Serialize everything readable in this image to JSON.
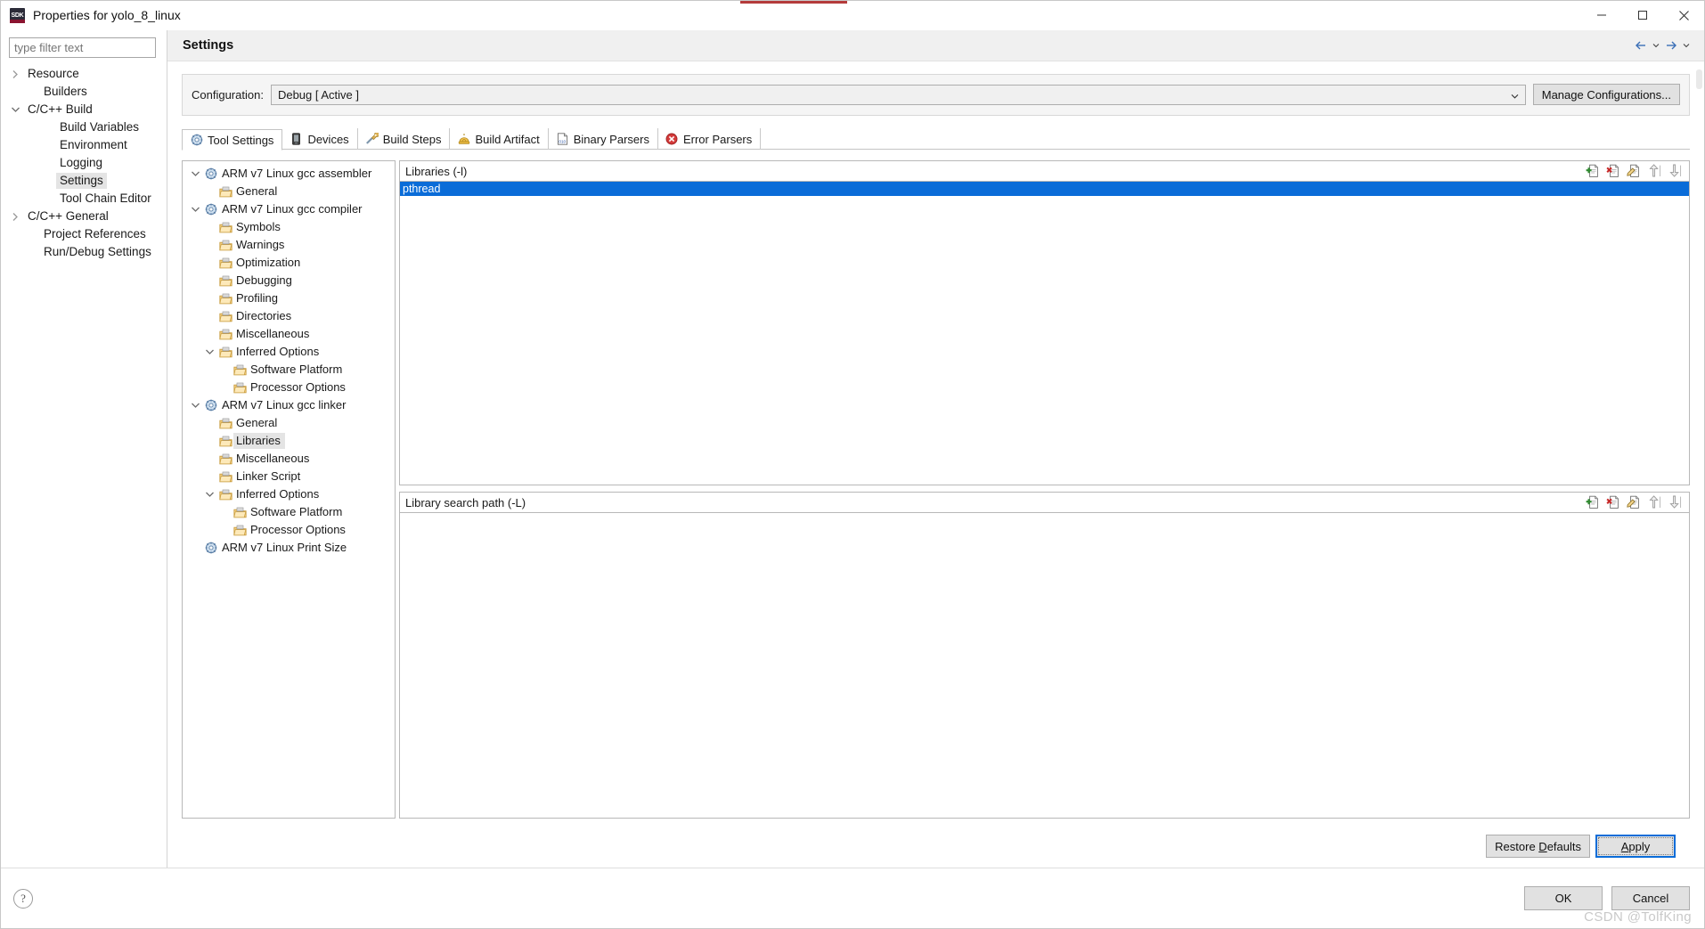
{
  "window": {
    "title": "Properties for yolo_8_linux",
    "icon": "sdk-icon",
    "minimize_label": "Minimize",
    "maximize_label": "Maximize",
    "close_label": "Close"
  },
  "left_nav": {
    "filter_placeholder": "type filter text",
    "items": [
      {
        "label": "Resource",
        "indent": 0,
        "twisty": "collapsed",
        "selected": false
      },
      {
        "label": "Builders",
        "indent": 1,
        "twisty": "none",
        "selected": false
      },
      {
        "label": "C/C++ Build",
        "indent": 0,
        "twisty": "expanded",
        "selected": false
      },
      {
        "label": "Build Variables",
        "indent": 2,
        "twisty": "none",
        "selected": false
      },
      {
        "label": "Environment",
        "indent": 2,
        "twisty": "none",
        "selected": false
      },
      {
        "label": "Logging",
        "indent": 2,
        "twisty": "none",
        "selected": false
      },
      {
        "label": "Settings",
        "indent": 2,
        "twisty": "none",
        "selected": true
      },
      {
        "label": "Tool Chain Editor",
        "indent": 2,
        "twisty": "none",
        "selected": false
      },
      {
        "label": "C/C++ General",
        "indent": 0,
        "twisty": "collapsed",
        "selected": false
      },
      {
        "label": "Project References",
        "indent": 1,
        "twisty": "none",
        "selected": false
      },
      {
        "label": "Run/Debug Settings",
        "indent": 1,
        "twisty": "none",
        "selected": false
      }
    ]
  },
  "page": {
    "title": "Settings",
    "nav_back": "back-icon",
    "nav_forward": "forward-icon"
  },
  "configuration": {
    "label": "Configuration:",
    "value": "Debug  [ Active ]",
    "manage_label": "Manage Configurations..."
  },
  "tabs": [
    {
      "label": "Tool Settings",
      "icon": "tool-settings-icon",
      "active": true
    },
    {
      "label": "Devices",
      "icon": "devices-icon",
      "active": false
    },
    {
      "label": "Build Steps",
      "icon": "build-steps-icon",
      "active": false
    },
    {
      "label": "Build Artifact",
      "icon": "build-artifact-icon",
      "active": false
    },
    {
      "label": "Binary Parsers",
      "icon": "binary-parsers-icon",
      "active": false
    },
    {
      "label": "Error Parsers",
      "icon": "error-parsers-icon",
      "active": false
    }
  ],
  "tool_tree": [
    {
      "label": "ARM v7 Linux gcc assembler",
      "indent": 0,
      "twisty": "expanded",
      "icon": "tool-icon",
      "selected": false
    },
    {
      "label": "General",
      "indent": 1,
      "twisty": "none",
      "icon": "folder-icon",
      "selected": false
    },
    {
      "label": "ARM v7 Linux gcc compiler",
      "indent": 0,
      "twisty": "expanded",
      "icon": "tool-icon",
      "selected": false
    },
    {
      "label": "Symbols",
      "indent": 1,
      "twisty": "none",
      "icon": "folder-icon",
      "selected": false
    },
    {
      "label": "Warnings",
      "indent": 1,
      "twisty": "none",
      "icon": "folder-icon",
      "selected": false
    },
    {
      "label": "Optimization",
      "indent": 1,
      "twisty": "none",
      "icon": "folder-icon",
      "selected": false
    },
    {
      "label": "Debugging",
      "indent": 1,
      "twisty": "none",
      "icon": "folder-icon",
      "selected": false
    },
    {
      "label": "Profiling",
      "indent": 1,
      "twisty": "none",
      "icon": "folder-icon",
      "selected": false
    },
    {
      "label": "Directories",
      "indent": 1,
      "twisty": "none",
      "icon": "folder-icon",
      "selected": false
    },
    {
      "label": "Miscellaneous",
      "indent": 1,
      "twisty": "none",
      "icon": "folder-icon",
      "selected": false
    },
    {
      "label": "Inferred Options",
      "indent": 1,
      "twisty": "expanded",
      "icon": "folder-icon",
      "selected": false
    },
    {
      "label": "Software Platform",
      "indent": 2,
      "twisty": "none",
      "icon": "folder-icon",
      "selected": false
    },
    {
      "label": "Processor Options",
      "indent": 2,
      "twisty": "none",
      "icon": "folder-icon",
      "selected": false
    },
    {
      "label": "ARM v7 Linux gcc linker",
      "indent": 0,
      "twisty": "expanded",
      "icon": "tool-icon",
      "selected": false
    },
    {
      "label": "General",
      "indent": 1,
      "twisty": "none",
      "icon": "folder-icon",
      "selected": false
    },
    {
      "label": "Libraries",
      "indent": 1,
      "twisty": "none",
      "icon": "folder-icon",
      "selected": true
    },
    {
      "label": "Miscellaneous",
      "indent": 1,
      "twisty": "none",
      "icon": "folder-icon",
      "selected": false
    },
    {
      "label": "Linker Script",
      "indent": 1,
      "twisty": "none",
      "icon": "folder-icon",
      "selected": false
    },
    {
      "label": "Inferred Options",
      "indent": 1,
      "twisty": "expanded",
      "icon": "folder-icon",
      "selected": false
    },
    {
      "label": "Software Platform",
      "indent": 2,
      "twisty": "none",
      "icon": "folder-icon",
      "selected": false
    },
    {
      "label": "Processor Options",
      "indent": 2,
      "twisty": "none",
      "icon": "folder-icon",
      "selected": false
    },
    {
      "label": "ARM v7 Linux Print Size",
      "indent": 0,
      "twisty": "none",
      "icon": "tool-icon",
      "selected": false
    }
  ],
  "libraries_panel": {
    "title": "Libraries (-l)",
    "tools": [
      {
        "name": "add-icon",
        "tip": "Add"
      },
      {
        "name": "delete-icon",
        "tip": "Delete"
      },
      {
        "name": "edit-icon",
        "tip": "Edit"
      },
      {
        "name": "move-up-icon",
        "tip": "Move Up"
      },
      {
        "name": "move-down-icon",
        "tip": "Move Down"
      }
    ],
    "entries": [
      {
        "value": "pthread",
        "selected": true
      }
    ]
  },
  "library_search_panel": {
    "title": "Library search path (-L)",
    "tools": [
      {
        "name": "add-icon",
        "tip": "Add"
      },
      {
        "name": "delete-icon",
        "tip": "Delete"
      },
      {
        "name": "edit-icon",
        "tip": "Edit"
      },
      {
        "name": "move-up-icon",
        "tip": "Move Up"
      },
      {
        "name": "move-down-icon",
        "tip": "Move Down"
      }
    ],
    "entries": []
  },
  "buttons": {
    "restore_defaults": "Restore Defaults",
    "restore_defaults_mnemonic": "D",
    "apply": "Apply",
    "apply_mnemonic": "A",
    "ok": "OK",
    "cancel": "Cancel",
    "help": "?"
  },
  "watermark": "CSDN @TolfKing",
  "colors": {
    "selection_blue": "#0a6cd8",
    "tree_selection_gray": "#e4e4e4",
    "panel_bg": "#f5f5f5",
    "button_bg": "#e1e1e1",
    "border": "#b8b8b8"
  }
}
